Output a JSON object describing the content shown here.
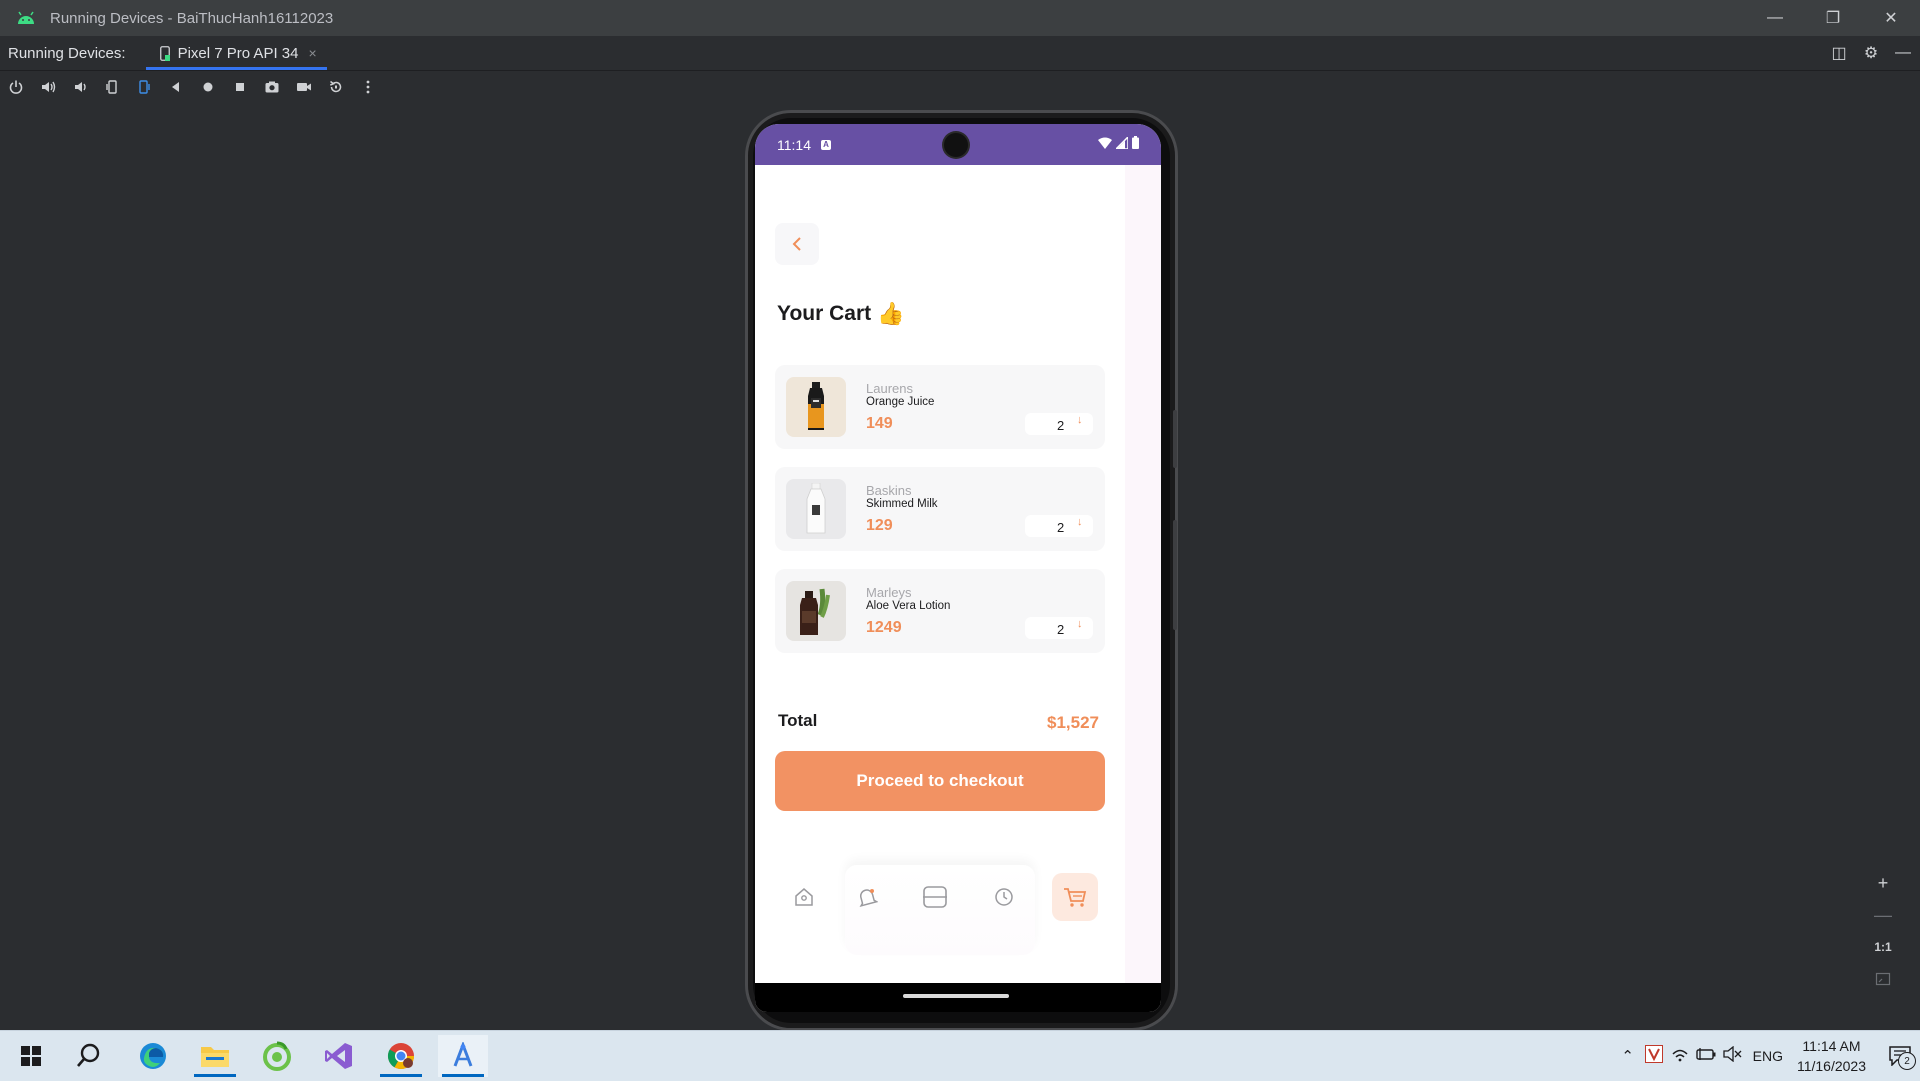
{
  "window": {
    "title": "Running Devices - BaiThucHanh16112023",
    "controls": [
      "minimize-icon",
      "restore-icon",
      "close-icon"
    ]
  },
  "device_panel": {
    "label": "Running Devices:",
    "tab_label": "Pixel 7 Pro API 34",
    "close_glyph": "×"
  },
  "emulator_toolbar": {
    "icons": [
      "power-icon",
      "volume-up-icon",
      "volume-down-icon",
      "rotate-left-icon",
      "rotate-right-icon",
      "back-icon",
      "home-icon",
      "overview-icon",
      "screenshot-icon",
      "screen-record-icon",
      "reset-icon",
      "more-icon"
    ]
  },
  "zoom": {
    "zoom_in": "+",
    "zoom_out": "—",
    "one_to_one": "1:1"
  },
  "phone": {
    "status_time": "11:14",
    "app": {
      "title": "Your Cart",
      "title_emoji": "👍",
      "items": [
        {
          "brand": "Laurens",
          "name": "Orange Juice",
          "price": "149",
          "qty": "2"
        },
        {
          "brand": "Baskins",
          "name": "Skimmed Milk",
          "price": "129",
          "qty": "2"
        },
        {
          "brand": "Marleys",
          "name": "Aloe Vera Lotion",
          "price": "1249",
          "qty": "2"
        }
      ],
      "total_label": "Total",
      "total_value": "$1,527",
      "checkout_label": "Proceed to checkout",
      "nav": [
        "home-icon",
        "bell-icon",
        "scan-icon",
        "history-icon",
        "cart-icon"
      ],
      "active_nav": "cart-icon"
    }
  },
  "taskbar": {
    "apps": [
      "windows-start-icon",
      "search-icon",
      "edge-icon",
      "file-explorer-icon",
      "app-green-icon",
      "visual-studio-icon",
      "chrome-icon",
      "android-studio-icon"
    ],
    "tray": {
      "lang": "ENG",
      "time": "11:14 AM",
      "date": "11/16/2023",
      "notifications": "2"
    }
  },
  "colors": {
    "accent_orange": "#f08e59",
    "checkout_button": "#f29263",
    "status_bar": "#6750a4",
    "ide_bg": "#2b2d30"
  }
}
